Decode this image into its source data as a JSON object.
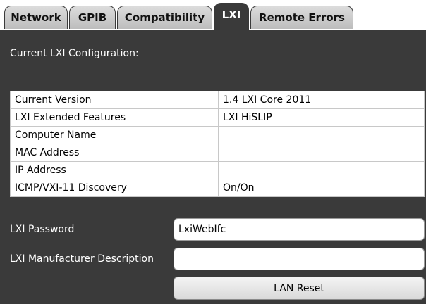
{
  "tabs": [
    {
      "label": "Network"
    },
    {
      "label": "GPIB"
    },
    {
      "label": "Compatibility"
    },
    {
      "label": "LXI",
      "active": true
    },
    {
      "label": "Remote Errors"
    }
  ],
  "section_title": "Current LXI Configuration:",
  "config_table": [
    {
      "key": "Current Version",
      "value": "1.4 LXI Core 2011"
    },
    {
      "key": "LXI Extended Features",
      "value": "LXI HiSLIP"
    },
    {
      "key": "Computer Name",
      "value": ""
    },
    {
      "key": "MAC Address",
      "value": ""
    },
    {
      "key": "IP Address",
      "value": ""
    },
    {
      "key": "ICMP/VXI-11 Discovery",
      "value": "On/On"
    }
  ],
  "password": {
    "label": "LXI Password",
    "value": "LxiWebIfc"
  },
  "manufacturer_description": {
    "label": "LXI Manufacturer Description",
    "value": ""
  },
  "lan_reset_label": "LAN Reset"
}
